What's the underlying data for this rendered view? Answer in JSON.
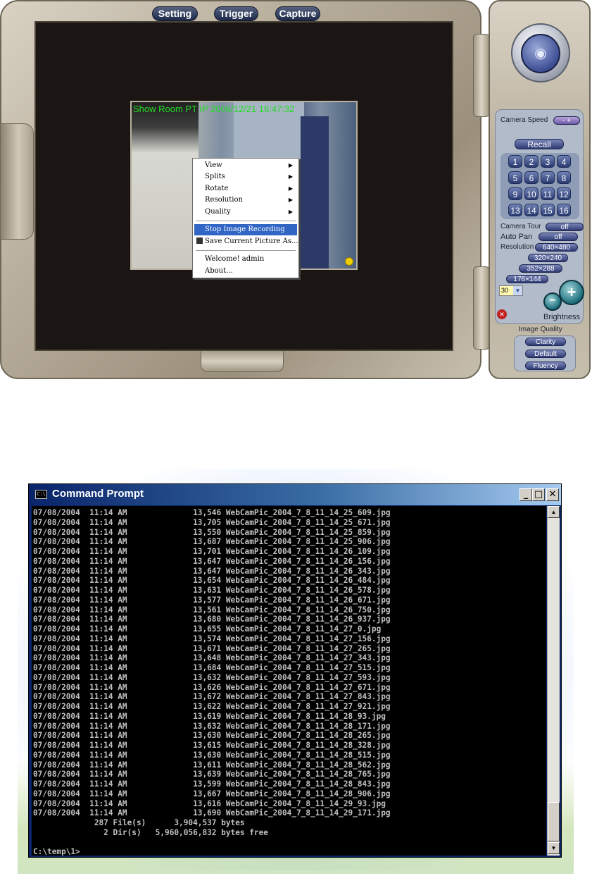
{
  "viewer": {
    "top_buttons": [
      "Setting",
      "Trigger",
      "Capture"
    ],
    "camera_overlay": "Show Room PT IP  2006/12/21  16:47:32",
    "context_menu": {
      "items": [
        "View",
        "Splits",
        "Rotate",
        "Resolution",
        "Quality"
      ],
      "stop_recording": "Stop Image Recording",
      "save_picture": "Save Current Picture As...",
      "welcome": "Welcome! admin",
      "about": "About..."
    },
    "panel": {
      "camera_speed_label": "Camera Speed",
      "camera_speed_value": "- +",
      "recall_label": "Recall",
      "presets": [
        "1",
        "2",
        "3",
        "4",
        "5",
        "6",
        "7",
        "8",
        "9",
        "10",
        "11",
        "12",
        "13",
        "14",
        "15",
        "16"
      ],
      "camera_tour_label": "Camera Tour",
      "camera_tour_value": "off",
      "auto_pan_label": "Auto Pan",
      "auto_pan_value": "off",
      "resolution_label": "Resolution",
      "resolutions": [
        "640×480",
        "320×240",
        "352×288",
        "176×144"
      ],
      "frame_rate": "30",
      "brightness_label": "Brightness",
      "image_quality_label": "Image Quality",
      "quality_options": [
        "Clarity",
        "Default",
        "Fluency"
      ]
    }
  },
  "cmd": {
    "title": "Command Prompt",
    "lines": [
      "07/08/2004  11:14 AM              13,546 WebCamPic_2004_7_8_11_14_25_609.jpg",
      "07/08/2004  11:14 AM              13,705 WebCamPic_2004_7_8_11_14_25_671.jpg",
      "07/08/2004  11:14 AM              13,550 WebCamPic_2004_7_8_11_14_25_859.jpg",
      "07/08/2004  11:14 AM              13,687 WebCamPic_2004_7_8_11_14_25_906.jpg",
      "07/08/2004  11:14 AM              13,701 WebCamPic_2004_7_8_11_14_26_109.jpg",
      "07/08/2004  11:14 AM              13,647 WebCamPic_2004_7_8_11_14_26_156.jpg",
      "07/08/2004  11:14 AM              13,647 WebCamPic_2004_7_8_11_14_26_343.jpg",
      "07/08/2004  11:14 AM              13,654 WebCamPic_2004_7_8_11_14_26_484.jpg",
      "07/08/2004  11:14 AM              13,631 WebCamPic_2004_7_8_11_14_26_578.jpg",
      "07/08/2004  11:14 AM              13,577 WebCamPic_2004_7_8_11_14_26_671.jpg",
      "07/08/2004  11:14 AM              13,561 WebCamPic_2004_7_8_11_14_26_750.jpg",
      "07/08/2004  11:14 AM              13,680 WebCamPic_2004_7_8_11_14_26_937.jpg",
      "07/08/2004  11:14 AM              13,655 WebCamPic_2004_7_8_11_14_27_0.jpg",
      "07/08/2004  11:14 AM              13,574 WebCamPic_2004_7_8_11_14_27_156.jpg",
      "07/08/2004  11:14 AM              13,671 WebCamPic_2004_7_8_11_14_27_265.jpg",
      "07/08/2004  11:14 AM              13,648 WebCamPic_2004_7_8_11_14_27_343.jpg",
      "07/08/2004  11:14 AM              13,684 WebCamPic_2004_7_8_11_14_27_515.jpg",
      "07/08/2004  11:14 AM              13,632 WebCamPic_2004_7_8_11_14_27_593.jpg",
      "07/08/2004  11:14 AM              13,626 WebCamPic_2004_7_8_11_14_27_671.jpg",
      "07/08/2004  11:14 AM              13,672 WebCamPic_2004_7_8_11_14_27_843.jpg",
      "07/08/2004  11:14 AM              13,622 WebCamPic_2004_7_8_11_14_27_921.jpg",
      "07/08/2004  11:14 AM              13,619 WebCamPic_2004_7_8_11_14_28_93.jpg",
      "07/08/2004  11:14 AM              13,632 WebCamPic_2004_7_8_11_14_28_171.jpg",
      "07/08/2004  11:14 AM              13,630 WebCamPic_2004_7_8_11_14_28_265.jpg",
      "07/08/2004  11:14 AM              13,615 WebCamPic_2004_7_8_11_14_28_328.jpg",
      "07/08/2004  11:14 AM              13,630 WebCamPic_2004_7_8_11_14_28_515.jpg",
      "07/08/2004  11:14 AM              13,611 WebCamPic_2004_7_8_11_14_28_562.jpg",
      "07/08/2004  11:14 AM              13,639 WebCamPic_2004_7_8_11_14_28_765.jpg",
      "07/08/2004  11:14 AM              13,599 WebCamPic_2004_7_8_11_14_28_843.jpg",
      "07/08/2004  11:14 AM              13,667 WebCamPic_2004_7_8_11_14_28_906.jpg",
      "07/08/2004  11:14 AM              13,616 WebCamPic_2004_7_8_11_14_29_93.jpg",
      "07/08/2004  11:14 AM              13,690 WebCamPic_2004_7_8_11_14_29_171.jpg",
      "             287 File(s)      3,904,537 bytes",
      "               2 Dir(s)   5,960,056,832 bytes free",
      "",
      "C:\\temp\\1>"
    ]
  }
}
